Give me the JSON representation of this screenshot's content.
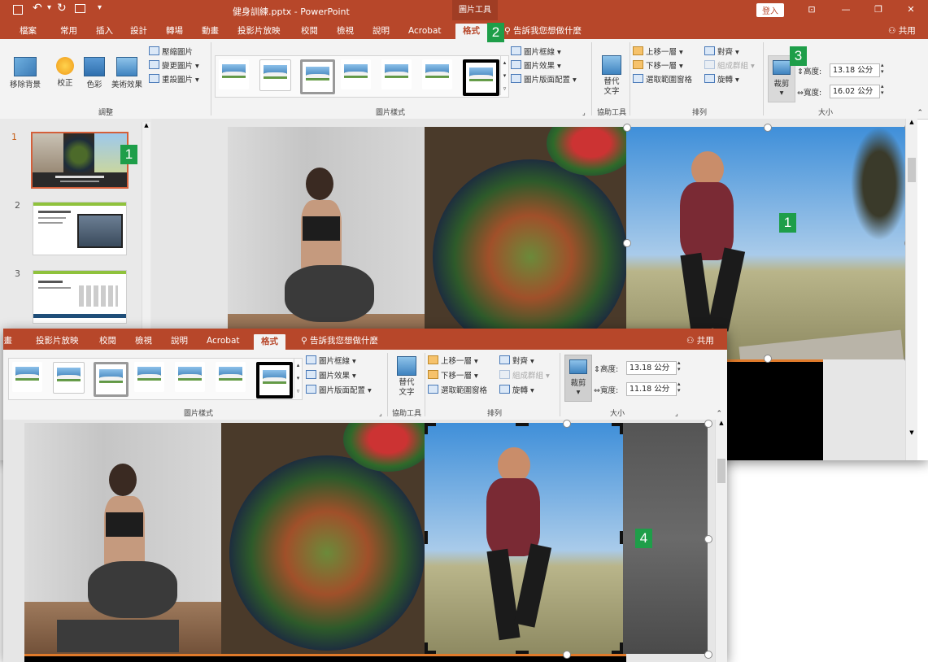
{
  "title_bar": {
    "file_title": "健身訓練.pptx - PowerPoint",
    "context_tab": "圖片工具",
    "login_button": "登入",
    "share_label": "共用"
  },
  "ribbon_tabs": [
    "檔案",
    "常用",
    "插入",
    "設計",
    "轉場",
    "動畫",
    "投影片放映",
    "校閱",
    "檢視",
    "說明",
    "Acrobat",
    "格式"
  ],
  "tell_me": "告訴我您想做什麼",
  "ribbon": {
    "adjust": {
      "remove_background": "移除背景",
      "corrections": "校正",
      "color": "色彩",
      "artistic_effects": "美術效果",
      "compress": "壓縮圖片",
      "change": "變更圖片",
      "reset": "重設圖片",
      "group_label": "調整"
    },
    "styles": {
      "border": "圖片框線",
      "effects": "圖片效果",
      "layout": "圖片版面配置",
      "group_label": "圖片樣式"
    },
    "accessibility": {
      "alt_text_line1": "替代",
      "alt_text_line2": "文字",
      "group_label": "協助工具"
    },
    "arrange": {
      "bring_forward": "上移一層",
      "send_backward": "下移一層",
      "selection_pane": "選取範圍窗格",
      "align": "對齊",
      "group": "組成群組",
      "rotate": "旋轉",
      "group_label": "排列"
    },
    "size": {
      "crop": "裁剪",
      "height_label": "高度:",
      "width_label": "寬度:",
      "height_value": "13.18 公分",
      "width_value_before": "16.02 公分",
      "width_value_after": "11.18 公分",
      "group_label": "大小"
    }
  },
  "slides": [
    "1",
    "2",
    "3"
  ],
  "badges": {
    "slide_badge": "1",
    "photo_badge": "1",
    "format_tab_badge": "2",
    "crop_badge": "3",
    "result_badge": "4"
  },
  "colors": {
    "accent": "#b7472a",
    "badge": "#1e9e49",
    "ribbon_bg": "#f3f3f3"
  }
}
